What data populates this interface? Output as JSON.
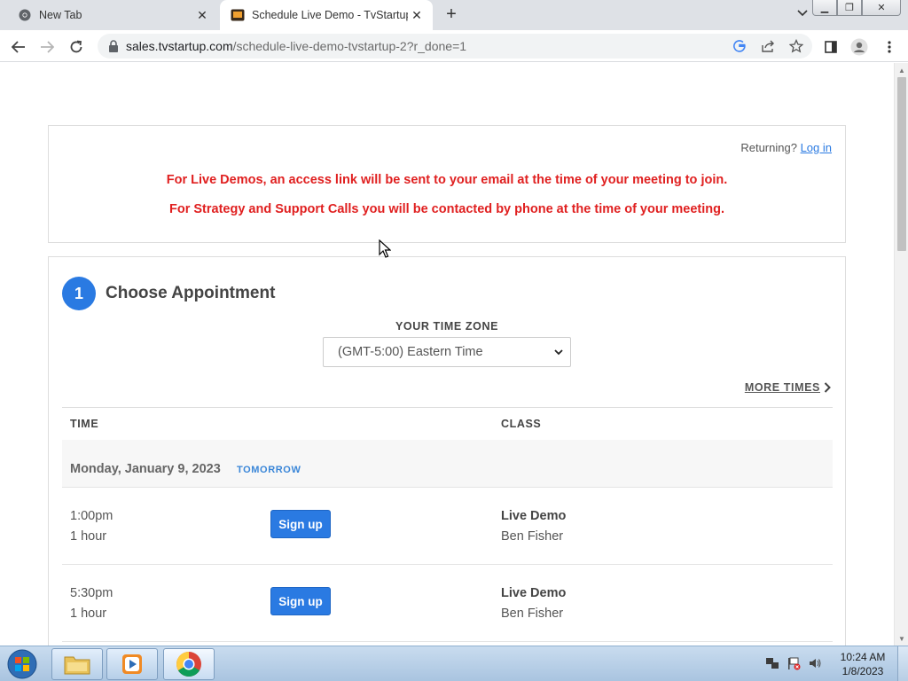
{
  "browser": {
    "tabs": [
      {
        "title": "New Tab",
        "active": false
      },
      {
        "title": "Schedule Live Demo - TvStartup",
        "active": true
      }
    ],
    "url_host": "sales.tvstartup.com",
    "url_path": "/schedule-live-demo-tvstartup-2?r_done=1"
  },
  "notice": {
    "returning_text": "Returning?",
    "login_link": "Log in",
    "line1": "For Live Demos, an access link will be sent to your email at the time of your meeting to join.",
    "line2": "For Strategy and Support Calls you will be contacted by phone at the time of your meeting."
  },
  "appointment": {
    "step_number": "1",
    "step_title": "Choose Appointment",
    "timezone_label": "YOUR TIME ZONE",
    "timezone_value": "(GMT-5:00) Eastern Time",
    "more_times": "MORE TIMES",
    "table_headers": {
      "time": "TIME",
      "class": "CLASS"
    },
    "date": "Monday, January 9, 2023",
    "date_badge": "TOMORROW",
    "slots": [
      {
        "time": "1:00pm",
        "duration": "1 hour",
        "button": "Sign up",
        "class_name": "Live Demo",
        "instructor": "Ben Fisher"
      },
      {
        "time": "5:30pm",
        "duration": "1 hour",
        "button": "Sign up",
        "class_name": "Live Demo",
        "instructor": "Ben Fisher"
      }
    ]
  },
  "taskbar": {
    "time": "10:24 AM",
    "date": "1/8/2023"
  },
  "colors": {
    "accent": "#2a7ae2",
    "notice_red": "#e02020"
  }
}
